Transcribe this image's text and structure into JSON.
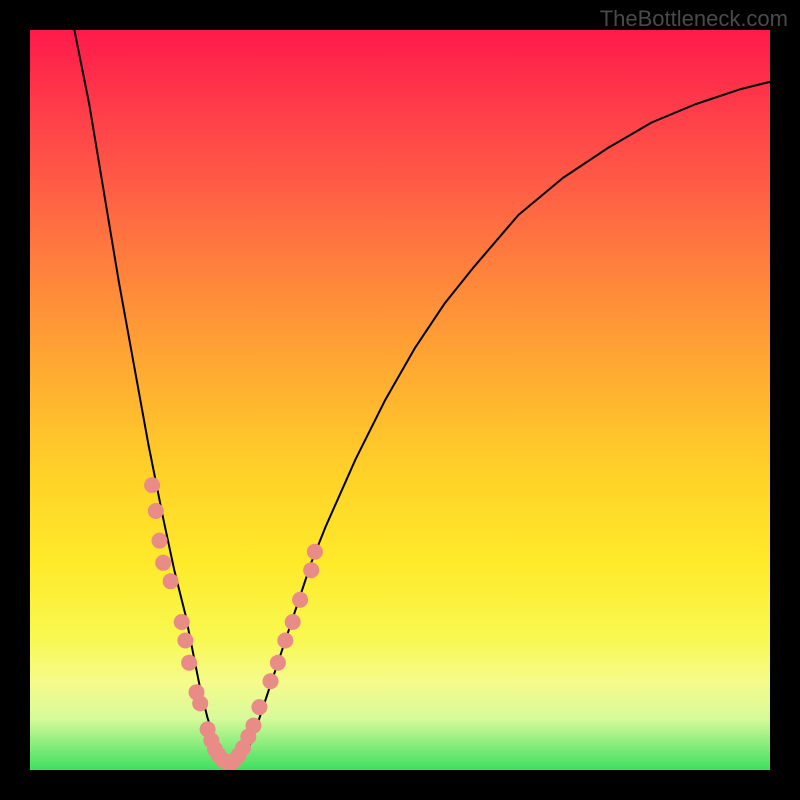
{
  "watermark": "TheBottleneck.com",
  "chart_data": {
    "type": "line",
    "title": "",
    "xlabel": "",
    "ylabel": "",
    "xlim": [
      0,
      100
    ],
    "ylim": [
      0,
      100
    ],
    "series": [
      {
        "name": "curve",
        "x": [
          6,
          8,
          10,
          12,
          14,
          16,
          18,
          19.5,
          21,
          22,
          23,
          24,
          25,
          26,
          27,
          28,
          29,
          30,
          32,
          34,
          36,
          38,
          40,
          44,
          48,
          52,
          56,
          60,
          66,
          72,
          78,
          84,
          90,
          96,
          100
        ],
        "values": [
          100,
          90,
          78,
          66,
          55,
          44,
          34,
          27,
          21,
          16,
          11,
          7,
          4,
          2,
          1,
          1,
          2,
          4,
          10,
          16,
          22,
          28,
          33,
          42,
          50,
          57,
          63,
          68,
          75,
          80,
          84,
          87.5,
          90,
          92,
          93
        ]
      }
    ],
    "markers": [
      {
        "x": 16.5,
        "y": 38.5
      },
      {
        "x": 17.0,
        "y": 35.0
      },
      {
        "x": 17.5,
        "y": 31.0
      },
      {
        "x": 18.0,
        "y": 28.0
      },
      {
        "x": 19.0,
        "y": 25.5
      },
      {
        "x": 20.5,
        "y": 20.0
      },
      {
        "x": 21.0,
        "y": 17.5
      },
      {
        "x": 21.5,
        "y": 14.5
      },
      {
        "x": 22.5,
        "y": 10.5
      },
      {
        "x": 23.0,
        "y": 9.0
      },
      {
        "x": 24.0,
        "y": 5.5
      },
      {
        "x": 24.5,
        "y": 4.0
      },
      {
        "x": 25.0,
        "y": 2.8
      },
      {
        "x": 25.5,
        "y": 2.0
      },
      {
        "x": 26.0,
        "y": 1.4
      },
      {
        "x": 26.5,
        "y": 1.1
      },
      {
        "x": 27.0,
        "y": 1.0
      },
      {
        "x": 27.5,
        "y": 1.2
      },
      {
        "x": 28.2,
        "y": 2.0
      },
      {
        "x": 28.8,
        "y": 3.0
      },
      {
        "x": 29.5,
        "y": 4.5
      },
      {
        "x": 30.2,
        "y": 6.0
      },
      {
        "x": 31.0,
        "y": 8.5
      },
      {
        "x": 32.5,
        "y": 12.0
      },
      {
        "x": 33.5,
        "y": 14.5
      },
      {
        "x": 34.5,
        "y": 17.5
      },
      {
        "x": 35.5,
        "y": 20.0
      },
      {
        "x": 36.5,
        "y": 23.0
      },
      {
        "x": 38.0,
        "y": 27.0
      },
      {
        "x": 38.5,
        "y": 29.5
      }
    ]
  }
}
